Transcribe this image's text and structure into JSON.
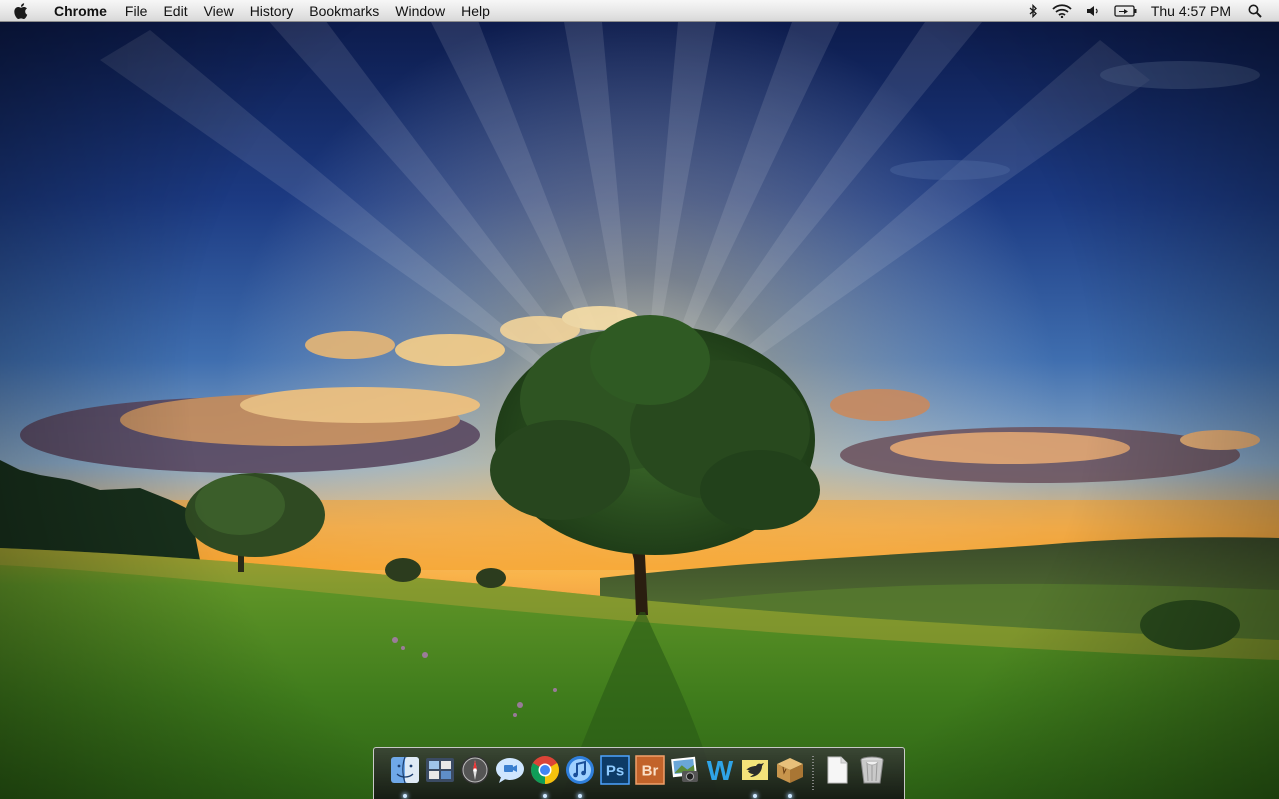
{
  "menubar": {
    "apple_icon": "apple-logo-icon",
    "app_name": "Chrome",
    "menus": [
      "File",
      "Edit",
      "View",
      "History",
      "Bookmarks",
      "Window",
      "Help"
    ],
    "status": {
      "icons": [
        "bluetooth-icon",
        "wifi-icon",
        "volume-icon",
        "battery-icon",
        "spotlight-search-icon"
      ],
      "clock": "Thu 4:57 PM"
    }
  },
  "wallpaper": {
    "description_icon": "landscape-wallpaper"
  },
  "dock": {
    "apps": [
      {
        "icon": "finder-icon",
        "running": true
      },
      {
        "icon": "dashboard-icon",
        "running": false
      },
      {
        "icon": "compass-icon",
        "running": false
      },
      {
        "icon": "ichat-icon",
        "running": false
      },
      {
        "icon": "chrome-icon",
        "running": true
      },
      {
        "icon": "itunes-icon",
        "running": true
      },
      {
        "icon": "photoshop-icon",
        "label": "Ps",
        "running": false
      },
      {
        "icon": "bridge-icon",
        "label": "Br",
        "running": false
      },
      {
        "icon": "iphoto-icon",
        "running": false
      },
      {
        "icon": "word-w-icon",
        "label": "W",
        "running": false
      },
      {
        "icon": "twitter-bird-icon",
        "running": true
      },
      {
        "icon": "package-box-icon",
        "running": true
      }
    ],
    "stacks": [
      {
        "icon": "document-icon",
        "running": false
      },
      {
        "icon": "trash-icon",
        "running": false
      }
    ]
  },
  "colors": {
    "menubar_bg": "#e6e6e6",
    "sky_top": "#0c1a46",
    "sunset": "#f5a623",
    "grass": "#4d8a22",
    "dock_bg": "#2a2a2a"
  }
}
